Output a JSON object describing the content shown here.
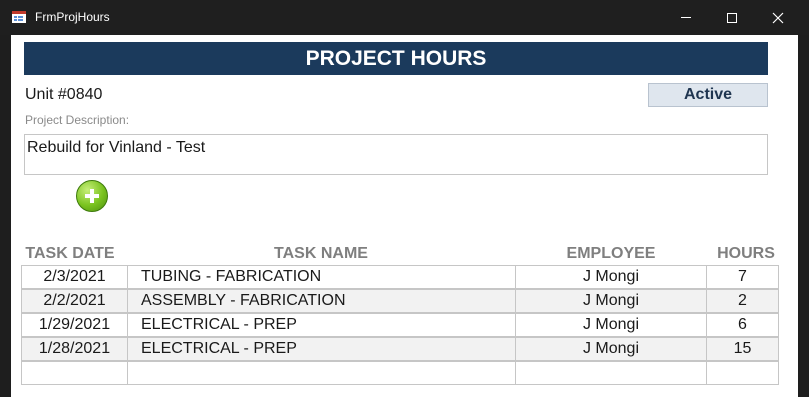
{
  "window": {
    "title": "FrmProjHours",
    "minimize_glyph": "—",
    "maximize_glyph": "☐",
    "close_glyph": "✕",
    "icon": "access-form-icon"
  },
  "form": {
    "header_title": "PROJECT HOURS",
    "unit": "Unit #0840",
    "status": "Active",
    "description_label": "Project Description:",
    "description": "Rebuild for Vinland - Test",
    "add_icon": "plus-circle-icon",
    "colors": {
      "header_bg": "#1b3a5c",
      "status_bg": "#dfe6ee",
      "add_green": "#79c21e"
    }
  },
  "tasks": {
    "columns": {
      "date": "TASK DATE",
      "task": "TASK NAME",
      "employee": "EMPLOYEE",
      "hours": "HOURS"
    },
    "rows": [
      {
        "date": "2/3/2021",
        "task": "TUBING - FABRICATION",
        "employee": "J Mongi",
        "hours": "7"
      },
      {
        "date": "2/2/2021",
        "task": "ASSEMBLY - FABRICATION",
        "employee": "J Mongi",
        "hours": "2"
      },
      {
        "date": "1/29/2021",
        "task": "ELECTRICAL - PREP",
        "employee": "J Mongi",
        "hours": "6"
      },
      {
        "date": "1/28/2021",
        "task": "ELECTRICAL - PREP",
        "employee": "J Mongi",
        "hours": "15"
      },
      {
        "date": "",
        "task": "",
        "employee": "",
        "hours": ""
      }
    ]
  }
}
